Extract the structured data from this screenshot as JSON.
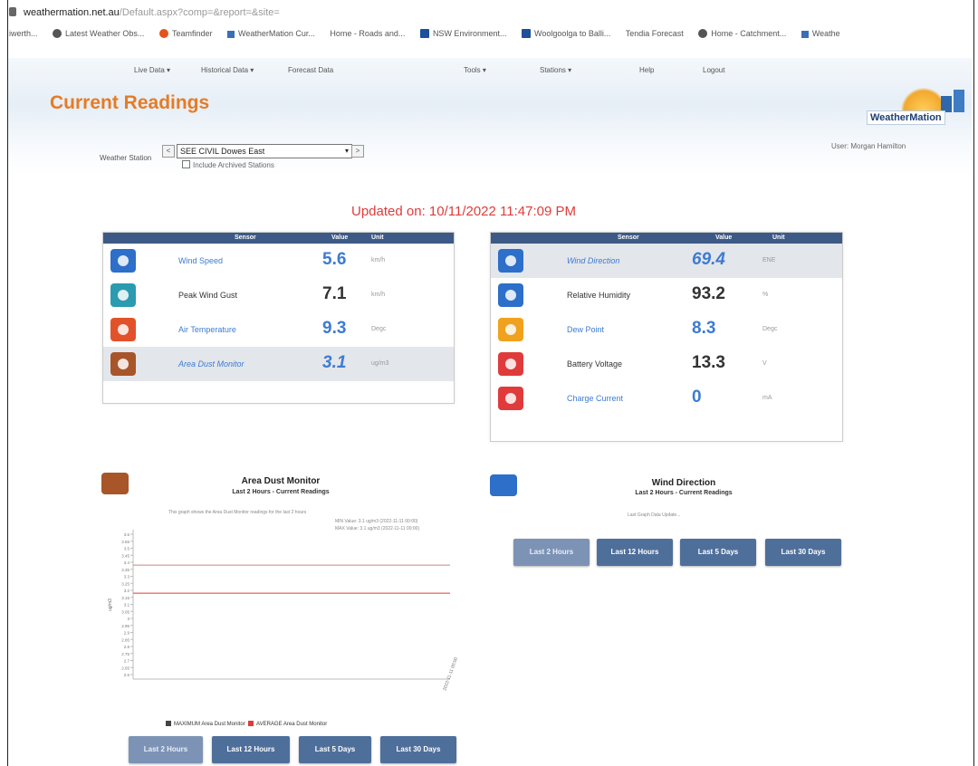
{
  "browser": {
    "address_host": "weathermation.net.au",
    "address_path": "/Default.aspx?comp=&report=&site=",
    "bookmarks": [
      {
        "label": "iwerth...",
        "icon": "none"
      },
      {
        "label": "Latest Weather Obs...",
        "icon": "globe-icon"
      },
      {
        "label": "Teamfinder",
        "icon": "orange-circle-icon"
      },
      {
        "label": "WeatherMation Cur...",
        "icon": "chart-icon"
      },
      {
        "label": "Home - Roads and...",
        "icon": "none"
      },
      {
        "label": "NSW Environment...",
        "icon": "square-icon"
      },
      {
        "label": "Woolgoolga to Balli...",
        "icon": "square-icon"
      },
      {
        "label": "Tendia Forecast",
        "icon": "none"
      },
      {
        "label": "Home - Catchment...",
        "icon": "globe-icon"
      },
      {
        "label": "Weathe",
        "icon": "chart-icon"
      }
    ]
  },
  "menu": {
    "live_data": "Live Data ▾",
    "historical": "Historical Data ▾",
    "forecast": "Forecast Data",
    "tools": "Tools ▾",
    "stations": "Stations ▾",
    "help": "Help",
    "logout": "Logout"
  },
  "page_title": "Current Readings",
  "logo_text": "WeatherMation",
  "user": "User: Morgan Hamilton",
  "station": {
    "label": "Weather Station",
    "prev": "<",
    "selected": "SEE CIVIL Dowes East",
    "next": ">",
    "include_archived": "Include Archived Stations"
  },
  "updated": "Updated on: 10/11/2022 11:47:09 PM",
  "table_headers": {
    "sensor": "Sensor",
    "value": "Value",
    "unit": "Unit"
  },
  "left_sensors": [
    {
      "name": "Wind Speed",
      "value": "5.6",
      "unit": "km/h",
      "icon": "wind-speed-icon",
      "color": "#2d6fc9"
    },
    {
      "name": "Peak Wind Gust",
      "value": "7.1",
      "unit": "km/h",
      "icon": "wind-gust-icon",
      "color": "#2a9bb0"
    },
    {
      "name": "Air Temperature",
      "value": "9.3",
      "unit": "Degc",
      "icon": "thermometer-icon",
      "color": "#e2522a"
    },
    {
      "name": "Area Dust Monitor",
      "value": "3.1",
      "unit": "ug/m3",
      "icon": "dust-icon",
      "color": "#a8552a"
    }
  ],
  "right_sensors": [
    {
      "name": "Wind Direction",
      "value": "69.4",
      "unit": "ENE",
      "icon": "wind-direction-icon",
      "color": "#2d6fc9"
    },
    {
      "name": "Relative Humidity",
      "value": "93.2",
      "unit": "%",
      "icon": "humidity-icon",
      "color": "#2d6fc9"
    },
    {
      "name": "Dew Point",
      "value": "8.3",
      "unit": "Degc",
      "icon": "dew-point-icon",
      "color": "#f0a21e"
    },
    {
      "name": "Battery Voltage",
      "value": "13.3",
      "unit": "V",
      "icon": "battery-icon",
      "color": "#e03b3b"
    },
    {
      "name": "Charge Current",
      "value": "0",
      "unit": "mA",
      "icon": "charge-icon",
      "color": "#e03b3b"
    }
  ],
  "dust_chart": {
    "title": "Area Dust Monitor",
    "subtitle": "Last 2 Hours - Current Readings",
    "note": "This graph shows the Area Dust Monitor readings for the last 2 hours",
    "min_label": "MIN Value: 3.1 ug/m3 (2022-11-11 00:00)",
    "max_label": "MAX Value: 3.1 ug/m3 (2022-11-11 00:00)",
    "ylabel": "ug/m3",
    "legend_max": "MAXIMUM Area Dust Monitor",
    "legend_avg": "AVERAGE Area Dust Monitor",
    "legend_max_color": "#444444",
    "legend_avg_color": "#e03b3b",
    "x_tick": "2022-11-11 00:00"
  },
  "chart_data": {
    "type": "line",
    "title": "Area Dust Monitor",
    "subtitle": "Last 2 Hours - Current Readings",
    "xlabel": "",
    "ylabel": "ug/m3",
    "yticks": [
      "3.6",
      "3.55",
      "3.5",
      "3.45",
      "3.4",
      "3.35",
      "3.3",
      "3.25",
      "3.2",
      "3.15",
      "3.1",
      "3.05",
      "3",
      "2.95",
      "2.9",
      "2.85",
      "2.8",
      "2.75",
      "2.7",
      "2.65",
      "2.6"
    ],
    "ylim": [
      2.6,
      3.6
    ],
    "series": [
      {
        "name": "MAXIMUM Area Dust Monitor",
        "color": "#444444",
        "values": [
          3.1
        ]
      },
      {
        "name": "AVERAGE Area Dust Monitor",
        "color": "#e03b3b",
        "values": [
          3.1
        ]
      }
    ],
    "x": [
      "2022-11-11 00:00"
    ]
  },
  "wind_chart": {
    "title": "Wind Direction",
    "subtitle": "Last 2 Hours - Current Readings",
    "note": "Last Graph Data Update..."
  },
  "range_buttons": [
    "Last 2 Hours",
    "Last 12 Hours",
    "Last 5 Days",
    "Last 30 Days"
  ]
}
